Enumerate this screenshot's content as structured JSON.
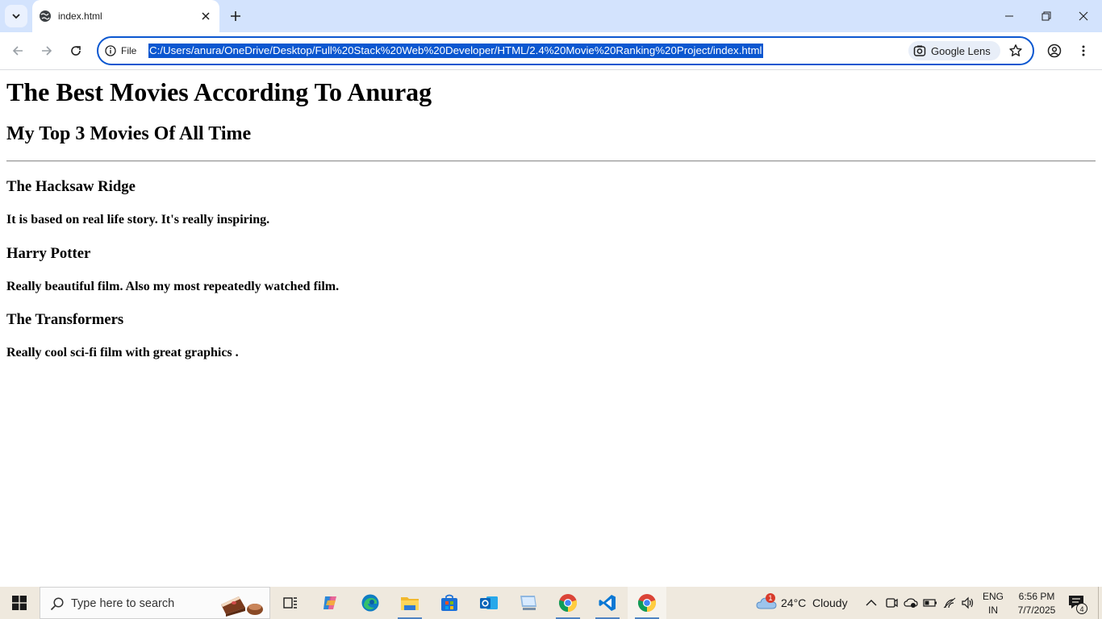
{
  "browser": {
    "tab": {
      "title": "index.html"
    },
    "address_bar": {
      "scheme_label": "File",
      "url": "C:/Users/anura/OneDrive/Desktop/Full%20Stack%20Web%20Developer/HTML/2.4%20Movie%20Ranking%20Project/index.html",
      "lens_label": "Google Lens"
    },
    "accent_color": "#0b57d0",
    "tab_strip_color": "#d3e3fd"
  },
  "page": {
    "title": "The Best Movies According To Anurag",
    "subtitle": "My Top 3 Movies Of All Time",
    "movies": [
      {
        "name": "The Hacksaw Ridge",
        "review": "It is based on real life story. It's really inspiring."
      },
      {
        "name": "Harry Potter",
        "review": "Really beautiful film. Also my most repeatedly watched film."
      },
      {
        "name": "The Transformers",
        "review": "Really cool sci-fi film with great graphics ."
      }
    ]
  },
  "taskbar": {
    "search_placeholder": "Type here to search",
    "apps": [
      "task-view",
      "copilot",
      "edge",
      "file-explorer",
      "microsoft-store",
      "outlook",
      "remote-desktop",
      "chrome",
      "vscode",
      "chrome"
    ],
    "weather": {
      "temp": "24°C",
      "condition": "Cloudy",
      "badge": "1"
    },
    "language": {
      "line1": "ENG",
      "line2": "IN"
    },
    "clock": {
      "time": "6:56 PM",
      "date": "7/7/2025"
    },
    "notifications": {
      "count": "4"
    }
  }
}
